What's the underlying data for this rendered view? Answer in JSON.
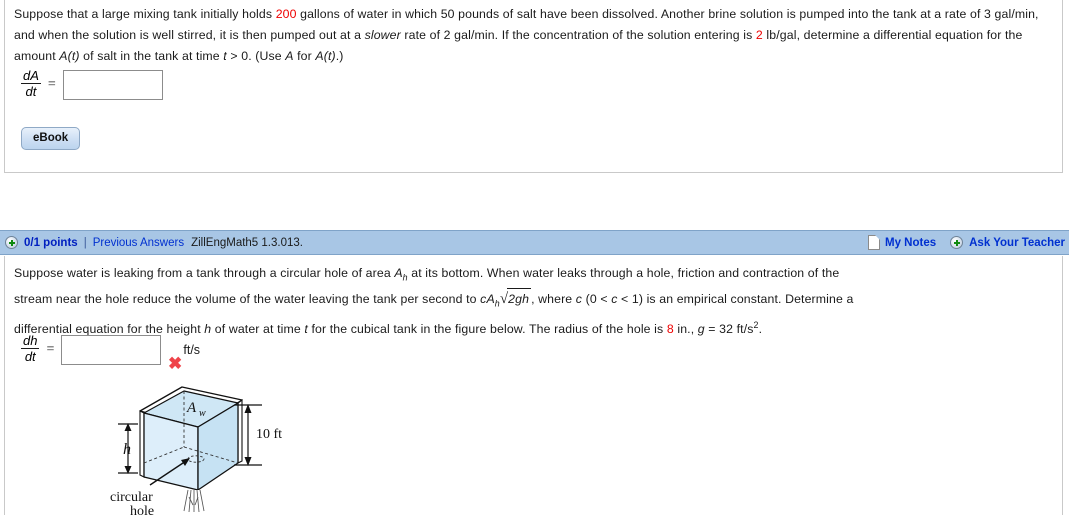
{
  "problem1": {
    "text_parts": [
      {
        "t": "Suppose that a large mixing tank initially holds ",
        "s": "plain"
      },
      {
        "t": "200",
        "s": "red"
      },
      {
        "t": " gallons of water in which 50 pounds of salt have been dissolved. Another brine solution is pumped into the tank at a rate of 3 gal/min, and when the solution is well stirred, it is then pumped out at a ",
        "s": "plain"
      },
      {
        "t": "slower",
        "s": "italic"
      },
      {
        "t": " rate of 2 gal/min. If the concentration of the solution entering is ",
        "s": "plain"
      },
      {
        "t": "2",
        "s": "red"
      },
      {
        "t": " lb/gal, determine a differential equation for the amount ",
        "s": "plain"
      },
      {
        "t": "A(t)",
        "s": "italic"
      },
      {
        "t": " of salt in the tank at time ",
        "s": "plain"
      },
      {
        "t": "t",
        "s": "italic"
      },
      {
        "t": " > 0.  (Use ",
        "s": "plain"
      },
      {
        "t": "A",
        "s": "italic"
      },
      {
        "t": " for ",
        "s": "plain"
      },
      {
        "t": "A(t)",
        "s": "italic"
      },
      {
        "t": ".)",
        "s": "plain"
      }
    ],
    "fraction": {
      "numerator": "dA",
      "denominator": "dt"
    },
    "equals_sign": "=",
    "answer_value": "",
    "answer_placeholder": "",
    "ebook_label": "eBook"
  },
  "problem2_header": {
    "points": "0/1 points",
    "separator": "|",
    "previous_answers": "Previous Answers",
    "question_id": "ZillEngMath5 1.3.013.",
    "my_notes": "My Notes",
    "ask_your_teacher": "Ask Your Teacher"
  },
  "problem2": {
    "line1": [
      {
        "t": "Suppose water is leaking from a tank through a circular hole of area ",
        "s": "plain"
      },
      {
        "t": "A",
        "s": "italic"
      },
      {
        "t": "h",
        "s": "sub-italic"
      },
      {
        "t": "  at its bottom. When water leaks through a hole, friction and contraction of the",
        "s": "plain"
      }
    ],
    "line2_pre": "stream near the hole reduce the volume of the water leaving the tank per second to ",
    "line2_expr": {
      "c": "c",
      "A": "A",
      "h": "h",
      "radicand": "2gh"
    },
    "line2_post": [
      {
        "t": ",  where ",
        "s": "plain"
      },
      {
        "t": "c",
        "s": "italic"
      },
      {
        "t": " (0 < ",
        "s": "plain"
      },
      {
        "t": "c",
        "s": "italic"
      },
      {
        "t": " < 1)  is an empirical constant. Determine a",
        "s": "plain"
      }
    ],
    "line3": [
      {
        "t": "differential equation for the height ",
        "s": "plain"
      },
      {
        "t": "h",
        "s": "italic"
      },
      {
        "t": " of water at time ",
        "s": "plain"
      },
      {
        "t": "t",
        "s": "italic"
      },
      {
        "t": " for the cubical tank in the figure below. The radius of the hole is ",
        "s": "plain"
      },
      {
        "t": "8",
        "s": "red"
      },
      {
        "t": " in.,  ",
        "s": "plain"
      },
      {
        "t": "g",
        "s": "italic"
      },
      {
        "t": " = 32 ft/s",
        "s": "plain"
      },
      {
        "t": "2",
        "s": "sup"
      },
      {
        "t": ".",
        "s": "plain"
      }
    ],
    "fraction": {
      "numerator": "dh",
      "denominator": "dt"
    },
    "equals_sign": "=",
    "answer_value": "",
    "answer_placeholder": "",
    "units": "ft/s",
    "incorrect_mark": "✖"
  },
  "figure": {
    "label_area": "A",
    "label_area_sub": "w",
    "label_height": "h",
    "label_dimension": "10 ft",
    "label_hole_line1": "circular",
    "label_hole_line2": "hole"
  },
  "colors": {
    "header_bar": "#a8c6e5",
    "link_blue": "#0030d0",
    "points_blue": "#0020c0",
    "highlight_red": "#ee0000",
    "incorrect_red": "#ef4349",
    "water_fill": "#cfe7f5",
    "water_fill_light": "#e4f2fa",
    "panel_border": "#c9c9c9"
  }
}
